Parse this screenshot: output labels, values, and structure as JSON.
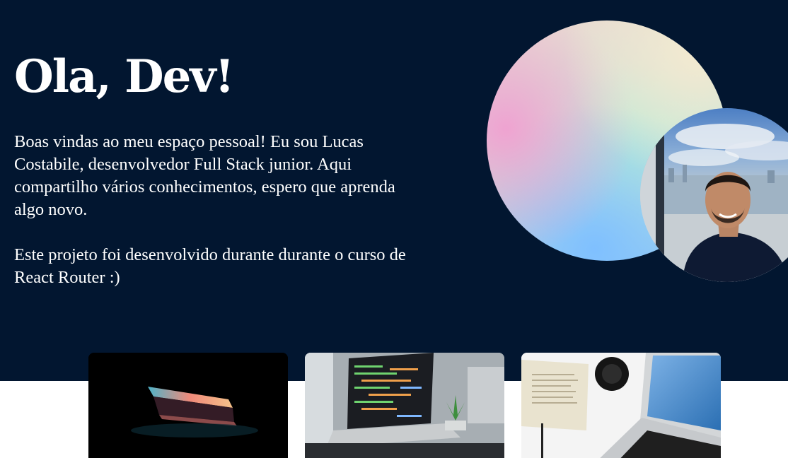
{
  "hero": {
    "title": "Ola, Dev!",
    "paragraph_1": "Boas vindas ao meu espaço pessoal! Eu sou Lucas Costabile, desenvolvedor Full Stack junior. Aqui compartilho vários conhecimentos, espero que aprenda algo novo.",
    "paragraph_2": "Este projeto foi desenvolvido durante durante o curso de React Router :)"
  },
  "colors": {
    "hero_background": "#021630",
    "page_background": "#ffffff",
    "text": "#ffffff"
  },
  "images": {
    "profile": "profile-photo",
    "cards": [
      "closed-laptop-photo",
      "code-laptop-photo",
      "desk-laptop-photo"
    ]
  }
}
